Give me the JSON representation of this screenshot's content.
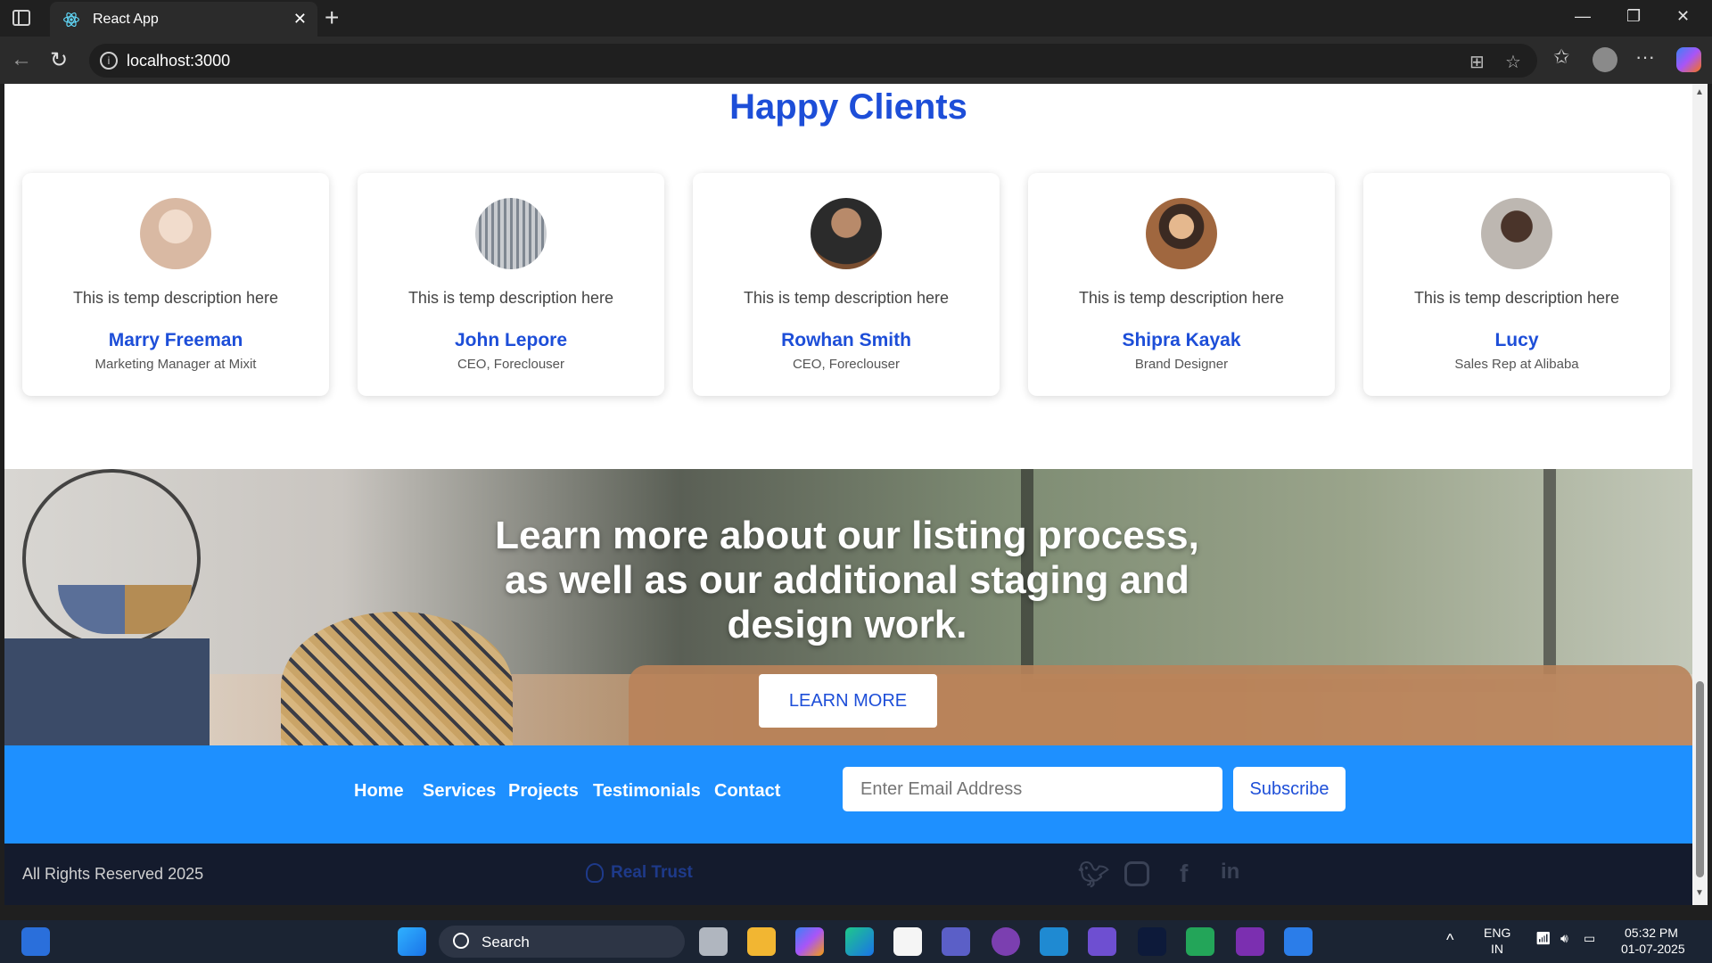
{
  "browser": {
    "tab_title": "React App",
    "url": "localhost:3000"
  },
  "page": {
    "section_title": "Happy Clients",
    "clients": [
      {
        "description": "This is temp description here",
        "name": "Marry Freeman",
        "role": "Marketing Manager at Mixit",
        "avatar_color": "#d9b9a3"
      },
      {
        "description": "This is temp description here",
        "name": "John Lepore",
        "role": "CEO, Foreclouser",
        "avatar_color": "#8e9aa6"
      },
      {
        "description": "This is temp description here",
        "name": "Rowhan Smith",
        "role": "CEO, Foreclouser",
        "avatar_color": "#6b4a3a"
      },
      {
        "description": "This is temp description here",
        "name": "Shipra Kayak",
        "role": "Brand Designer",
        "avatar_color": "#8a5a3c"
      },
      {
        "description": "This is temp description here",
        "name": "Lucy",
        "role": "Sales Rep at Alibaba",
        "avatar_color": "#5a4d45"
      }
    ],
    "banner": {
      "heading": "Learn more about our listing process, as well as our additional staging and design work.",
      "button": "LEARN MORE"
    },
    "footer": {
      "links": [
        "Home",
        "Services",
        "Projects",
        "Testimonials",
        "Contact"
      ],
      "email_placeholder": "Enter Email Address",
      "subscribe": "Subscribe",
      "rights": "All Rights Reserved 2025",
      "brand": "Real Trust",
      "social_icons": [
        "twitter-icon",
        "instagram-icon",
        "facebook-icon",
        "linkedin-icon"
      ]
    },
    "accent_color": "#1d4ed8",
    "footer_blue": "#1e90ff"
  },
  "taskbar": {
    "search_label": "Search",
    "language": "ENG",
    "region": "IN",
    "time": "05:32 PM",
    "date": "01-07-2025"
  }
}
